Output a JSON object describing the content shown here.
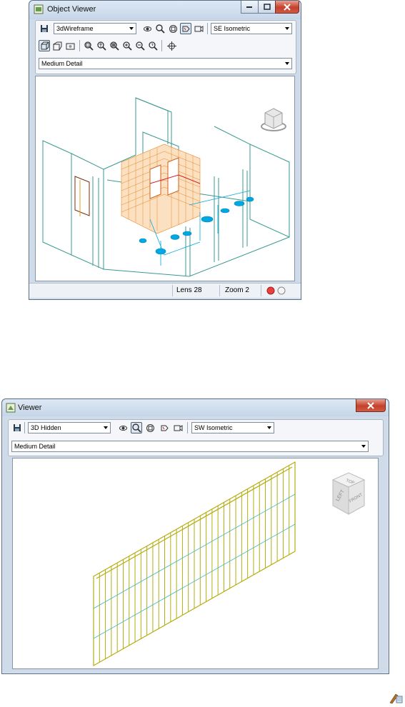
{
  "object_viewer": {
    "title": "Object Viewer",
    "visual_style": "3dWireframe",
    "view_direction": "SE Isometric",
    "detail_level": "Medium Detail",
    "status": {
      "lens": "Lens 28",
      "zoom": "Zoom 2"
    }
  },
  "viewer": {
    "title": "Viewer",
    "visual_style": "3D Hidden",
    "view_direction": "SW Isometric",
    "detail_level": "Medium Detail",
    "viewcube": {
      "top": "TOP",
      "left": "LEFT",
      "front": "FRONT"
    }
  },
  "colors": {
    "title_bar": "#c6d6e8",
    "close_button": "#c4412b",
    "masonry_orange": "#e8841e",
    "wall_teal": "#3a9a90",
    "fixture_cyan": "#00a8e0",
    "curtain_wall_olive": "#b5ad12"
  },
  "icons": [
    "save-icon",
    "orbit-icon",
    "zoom-icon",
    "zoom-extents-icon",
    "lens-icon",
    "camera-icon",
    "ortho-icon",
    "perspective-icon",
    "render-icon",
    "zoom-window-icon",
    "zoom-realtime-icon",
    "zoom-all-icon",
    "zoom-in-icon",
    "zoom-out-icon",
    "zoom-previous-icon",
    "pan-icon",
    "edit-in-viewer-icon"
  ]
}
